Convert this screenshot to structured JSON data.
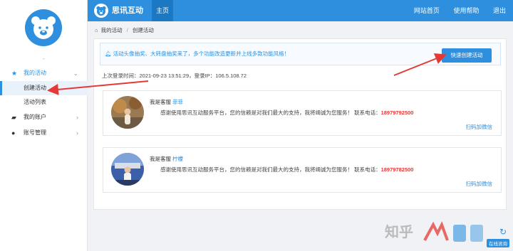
{
  "app": {
    "brand": "思讯互动",
    "home_tab": "主页"
  },
  "topbar": {
    "links": [
      "网站首页",
      "使用帮助",
      "退出"
    ]
  },
  "sidebar": {
    "user_text": "-",
    "items": [
      {
        "label": "我的活动",
        "icon": "star-icon",
        "active": true,
        "expanded": true,
        "children": [
          {
            "label": "创建活动",
            "selected": true
          },
          {
            "label": "活动列表",
            "selected": false
          }
        ]
      },
      {
        "label": "我的账户",
        "icon": "account-icon"
      },
      {
        "label": "账号管理",
        "icon": "user-icon"
      }
    ]
  },
  "breadcrumb": {
    "root": "我的活动",
    "separator": "/",
    "current": "创建活动"
  },
  "notice": {
    "text": "活动头像抽奖、大转盘抽奖来了，多个功能改造更新并上线多款功能风格！",
    "icon": "bell-icon"
  },
  "quick_create_label": "快速创建活动",
  "last_login": "上次登录时间：2021-09-23 13:51:29，登录IP：106.5.108.72",
  "support_cards": [
    {
      "title_prefix": "我是客服",
      "nickname": "菲菲",
      "message": "感谢使用思讯互动服务平台，您的信赖是对我们最大的支持，我将竭诚为您服务！ 联系电话：",
      "phone": "18979792500",
      "qr_link": "扫码加微信"
    },
    {
      "title_prefix": "我是客服",
      "nickname": "柠檬",
      "message": "感谢使用思讯互动服务平台，您的信赖是对我们最大的支持，我将竭诚为您服务！ 联系电话：",
      "phone": "18979782500",
      "qr_link": "扫码加微信"
    }
  ],
  "watermark": {
    "text": "知乎",
    "online_label": "在线咨询"
  },
  "colors": {
    "primary": "#2d8fdd",
    "phone": "#e53935",
    "annotation_arrow": "#e53935"
  }
}
